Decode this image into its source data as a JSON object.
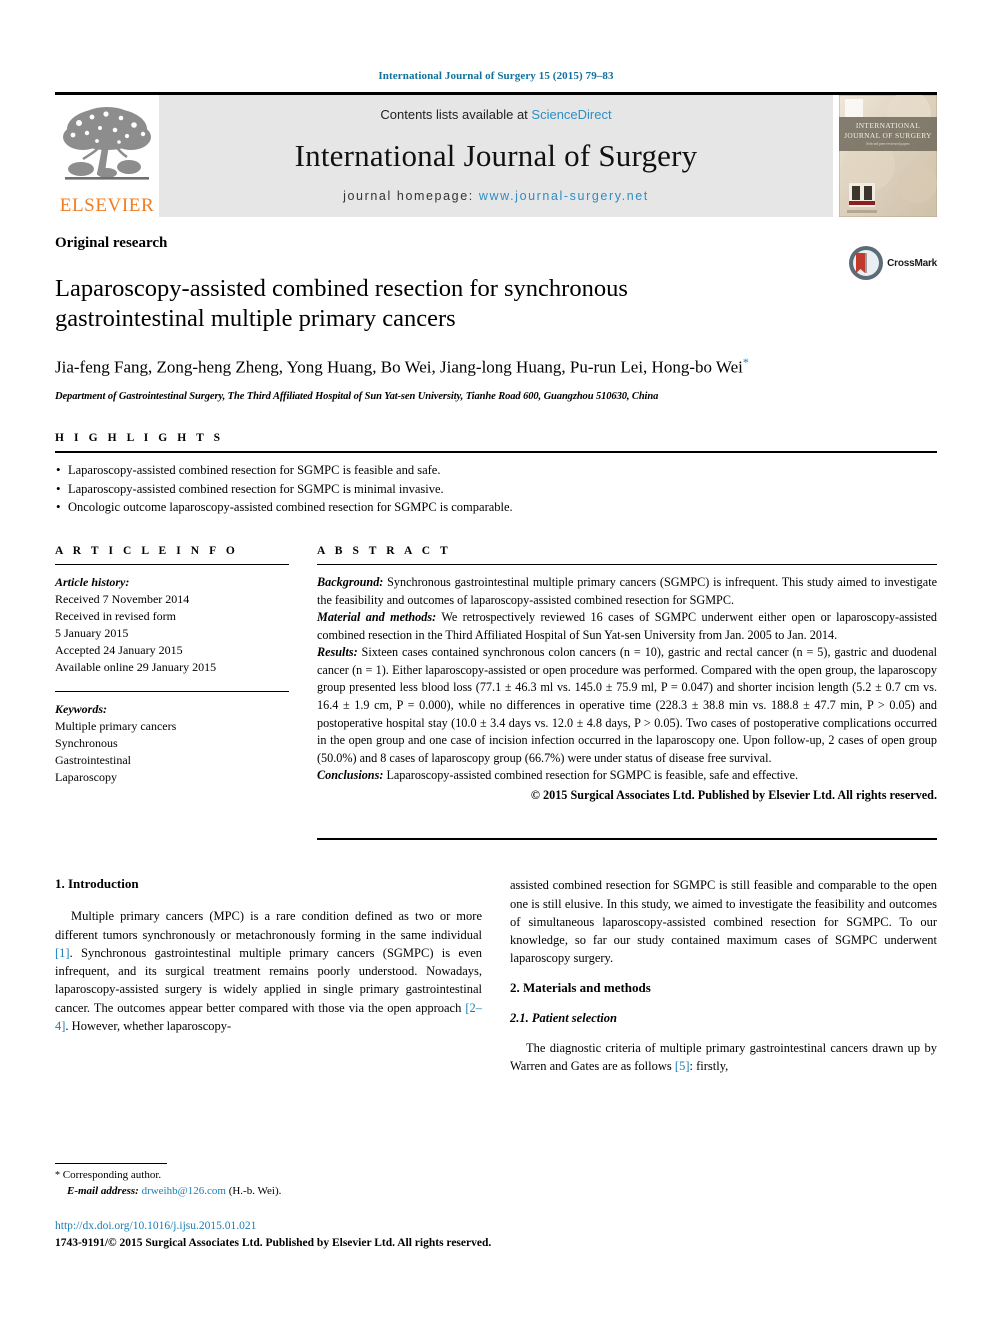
{
  "running_head": "International Journal of Surgery 15 (2015) 79–83",
  "masthead": {
    "contents_prefix": "Contents lists available at ",
    "sciencedirect": "ScienceDirect",
    "journal_title": "International Journal of Surgery",
    "homepage_prefix": "journal homepage: ",
    "homepage_url": "www.journal-surgery.net",
    "publisher_logo_text": "ELSEVIER",
    "cover_title_line1": "INTERNATIONAL",
    "cover_title_line2": "JOURNAL OF SURGERY",
    "link_color": "#2e8ec4",
    "band_color": "#e6e6e6",
    "elsevier_orange": "#f07d22"
  },
  "article": {
    "type": "Original research",
    "title": "Laparoscopy-assisted combined resection for synchronous gastrointestinal multiple primary cancers",
    "authors": "Jia-feng Fang, Zong-heng Zheng, Yong Huang, Bo Wei, Jiang-long Huang, Pu-run Lei, Hong-bo Wei",
    "corresponding_marker": "*",
    "affiliation": "Department of Gastrointestinal Surgery, The Third Affiliated Hospital of Sun Yat-sen University, Tianhe Road 600, Guangzhou 510630, China",
    "crossmark_label": "CrossMark"
  },
  "highlights": {
    "heading": "H I G H L I G H T S",
    "items": [
      "Laparoscopy-assisted combined resection for SGMPC is feasible and safe.",
      "Laparoscopy-assisted combined resection for SGMPC is minimal invasive.",
      "Oncologic outcome laparoscopy-assisted combined resection for SGMPC is comparable."
    ]
  },
  "article_info": {
    "heading": "A R T I C L E   I N F O",
    "history_label": "Article history:",
    "history": [
      "Received 7 November 2014",
      "Received in revised form",
      "5 January 2015",
      "Accepted 24 January 2015",
      "Available online 29 January 2015"
    ],
    "keywords_label": "Keywords:",
    "keywords": [
      "Multiple primary cancers",
      "Synchronous",
      "Gastrointestinal",
      "Laparoscopy"
    ]
  },
  "abstract": {
    "heading": "A B S T R A C T",
    "background_label": "Background:",
    "background_text": " Synchronous gastrointestinal multiple primary cancers (SGMPC) is infrequent. This study aimed to investigate the feasibility and outcomes of laparoscopy-assisted combined resection for SGMPC.",
    "methods_label": "Material and methods:",
    "methods_text": " We retrospectively reviewed 16 cases of SGMPC underwent either open or laparoscopy-assisted combined resection in the Third Affiliated Hospital of Sun Yat-sen University from Jan. 2005 to Jan. 2014.",
    "results_label": "Results:",
    "results_text": " Sixteen cases contained synchronous colon cancers (n = 10), gastric and rectal cancer (n = 5), gastric and duodenal cancer (n = 1). Either laparoscopy-assisted or open procedure was performed. Compared with the open group, the laparoscopy group presented less blood loss (77.1 ± 46.3 ml vs. 145.0 ± 75.9 ml, P = 0.047) and shorter incision length (5.2 ± 0.7 cm vs. 16.4 ± 1.9 cm, P = 0.000), while no differences in operative time (228.3 ± 38.8 min vs. 188.8 ± 47.7 min, P > 0.05) and postoperative hospital stay (10.0 ± 3.4 days vs. 12.0 ± 4.8 days, P > 0.05). Two cases of postoperative complications occurred in the open group and one case of incision infection occurred in the laparoscopy one. Upon follow-up, 2 cases of open group (50.0%) and 8 cases of laparoscopy group (66.7%) were under status of disease free survival.",
    "conclusions_label": "Conclusions:",
    "conclusions_text": " Laparoscopy-assisted combined resection for SGMPC is feasible, safe and effective.",
    "copyright": "© 2015 Surgical Associates Ltd. Published by Elsevier Ltd. All rights reserved."
  },
  "body": {
    "intro_heading": "1. Introduction",
    "intro_p1_a": "Multiple primary cancers (MPC) is a rare condition defined as two or more different tumors synchronously or metachronously forming in the same individual ",
    "intro_ref1": "[1]",
    "intro_p1_b": ". Synchronous gastrointestinal multiple primary cancers (SGMPC) is even infrequent, and its surgical treatment remains poorly understood. Nowadays, laparoscopy-assisted surgery is widely applied in single primary gastrointestinal cancer. The outcomes appear better compared with those via the open approach ",
    "intro_ref2": "[2–4]",
    "intro_p1_c": ". However, whether laparoscopy-assisted combined resection for SGMPC is still feasible and comparable to the open one is still elusive. In this study, we aimed to investigate the feasibility and outcomes of simultaneous laparoscopy-assisted combined resection for SGMPC. To our knowledge, so far our study contained maximum cases of SGMPC underwent laparoscopy surgery.",
    "methods_heading": "2. Materials and methods",
    "patient_selection_heading": "2.1. Patient selection",
    "patient_p_a": "The diagnostic criteria of multiple primary gastrointestinal cancers drawn up by Warren and Gates are as follows ",
    "patient_ref5": "[5]",
    "patient_p_b": ": firstly,"
  },
  "footnote": {
    "star": "*",
    "corresponding_author": "Corresponding author.",
    "email_label": "E-mail address:",
    "email": "drweihb@126.com",
    "email_suffix": "(H.-b. Wei)."
  },
  "footer": {
    "doi": "http://dx.doi.org/10.1016/j.ijsu.2015.01.021",
    "issn_line": "1743-9191/© 2015 Surgical Associates Ltd. Published by Elsevier Ltd. All rights reserved."
  }
}
